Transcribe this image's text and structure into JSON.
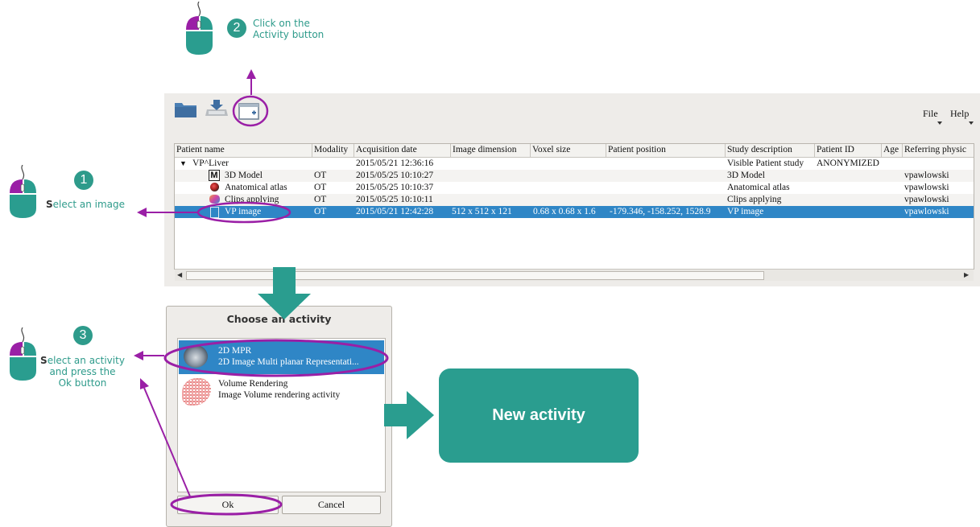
{
  "annotations": {
    "step1": {
      "number": "1",
      "lead": "S",
      "text": "elect an image"
    },
    "step2": {
      "number": "2",
      "line1": "Click on the",
      "line2": "Activity button"
    },
    "step3": {
      "number": "3",
      "lead": "S",
      "line1": "elect an activity",
      "line2": "and press the",
      "line3": "Ok button"
    }
  },
  "colors": {
    "teal": "#2a9d8f",
    "purple": "#9a1fa6",
    "selection": "#2f86c6"
  },
  "toolbar": {
    "icons": [
      "folder-open-icon",
      "import-icon",
      "activity-icon"
    ],
    "menu": {
      "file": "File",
      "help": "Help"
    }
  },
  "table": {
    "columns": [
      "Patient name",
      "Modality",
      "Acquisition date",
      "Image dimension",
      "Voxel size",
      "Patient position",
      "Study description",
      "Patient ID",
      "Age",
      "Referring physic"
    ],
    "rows": [
      {
        "name": "VP^Liver",
        "modality": "",
        "date": "2015/05/21 12:36:16",
        "dimension": "",
        "voxel": "",
        "position": "",
        "study": "Visible Patient study",
        "patient_id": "ANONYMIZED",
        "age": "",
        "physician": ""
      },
      {
        "name": "3D Model",
        "modality": "OT",
        "date": "2015/05/25 10:10:27",
        "dimension": "",
        "voxel": "",
        "position": "",
        "study": "3D Model",
        "patient_id": "",
        "age": "",
        "physician": "vpawlowski"
      },
      {
        "name": "Anatomical atlas",
        "modality": "OT",
        "date": "2015/05/25 10:10:37",
        "dimension": "",
        "voxel": "",
        "position": "",
        "study": "Anatomical atlas",
        "patient_id": "",
        "age": "",
        "physician": "vpawlowski"
      },
      {
        "name": "Clips applying",
        "modality": "OT",
        "date": "2015/05/25 10:10:11",
        "dimension": "",
        "voxel": "",
        "position": "",
        "study": "Clips applying",
        "patient_id": "",
        "age": "",
        "physician": "vpawlowski"
      },
      {
        "name": "VP image",
        "modality": "OT",
        "date": "2015/05/21 12:42:28",
        "dimension": "512 x 512 x 121",
        "voxel": "0.68 x 0.68 x 1.6",
        "position": "-179.346, -158.252, 1528.9",
        "study": "VP image",
        "patient_id": "",
        "age": "",
        "physician": "vpawlowski"
      }
    ]
  },
  "dialog": {
    "title": "Choose an activity",
    "activities": [
      {
        "name": "2D MPR",
        "description": "2D Image Multi planar Representati..."
      },
      {
        "name": "Volume Rendering",
        "description": "Image Volume rendering activity"
      }
    ],
    "ok_label": "Ok",
    "cancel_label": "Cancel"
  },
  "result": {
    "label": "New activity"
  }
}
